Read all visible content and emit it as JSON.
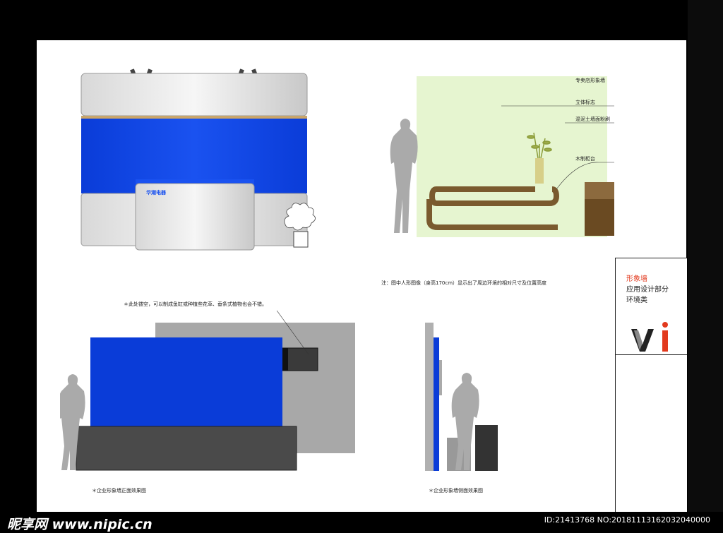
{
  "top_left": {
    "counter_logo": "华潮电器"
  },
  "top_right": {
    "labels": [
      "专卖店形象墙",
      "立体标志",
      "混泥土墙面粉刷",
      "木制柜台"
    ],
    "note": "注：图中人形图像（身高170cm）显示出了周边环境的相对尺寸及位置高度"
  },
  "bottom_left": {
    "annotation": "＊此处镂空，可以制成鱼缸或种植些花草、垂条式植物也会不错。",
    "caption": "＊企业形象墙正面效果图"
  },
  "bottom_right": {
    "caption": "＊企业形象墙侧面效果图"
  },
  "title_block": {
    "category": "形象墙",
    "dept": "应用设计部分",
    "sub": "环境类",
    "logo_letters": "vi"
  },
  "footer": {
    "brand": "昵享网 www.nipic.cn",
    "id_text": "ID:21413768 NO:20181113162032040000"
  },
  "colors": {
    "blue": "#0a3cd8",
    "light_green": "#e6f5d0",
    "brown": "#7a5a2e",
    "dark_gray": "#4a4a4a",
    "red": "#e23a1e"
  }
}
